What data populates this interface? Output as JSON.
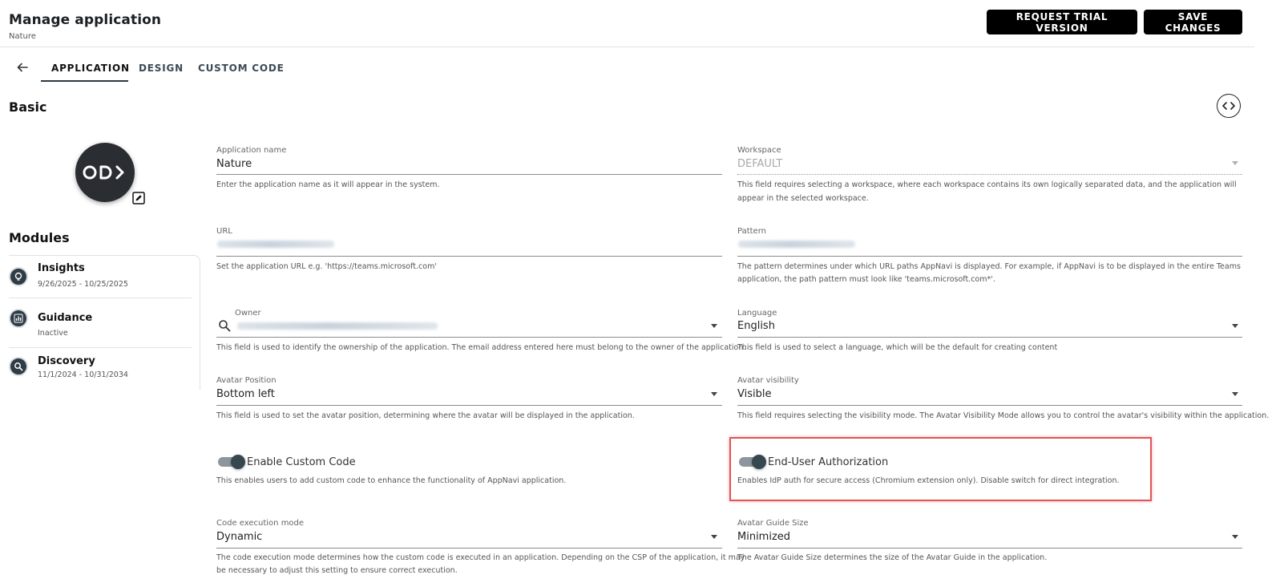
{
  "header": {
    "title": "Manage application",
    "subtitle": "Nature",
    "request_trial_label": "REQUEST TRIAL VERSION",
    "save_label": "SAVE CHANGES"
  },
  "tabs": [
    {
      "label": "APPLICATION",
      "active": true
    },
    {
      "label": "DESIGN",
      "active": false
    },
    {
      "label": "CUSTOM CODE",
      "active": false
    }
  ],
  "sections": {
    "basic": "Basic",
    "modules": "Modules"
  },
  "modules": [
    {
      "name": "Insights",
      "sub": "9/26/2025 - 10/25/2025",
      "icon": "insights-icon"
    },
    {
      "name": "Guidance",
      "sub": "Inactive",
      "icon": "bar-chart-icon"
    },
    {
      "name": "Discovery",
      "sub": "11/1/2024 - 10/31/2034",
      "icon": "search-icon"
    }
  ],
  "fields": {
    "app_name": {
      "label": "Application name",
      "value": "Nature",
      "help": "Enter the application name as it will appear in the system."
    },
    "workspace": {
      "label": "Workspace",
      "value": "DEFAULT",
      "help1": "This field requires selecting a workspace, where each workspace contains its own logically separated data, and the application will",
      "help2": "appear in the selected workspace."
    },
    "url": {
      "label": "URL",
      "help": "Set the application URL e.g. 'https://teams.microsoft.com'"
    },
    "pattern": {
      "label": "Pattern",
      "help1": "The pattern determines under which URL paths AppNavi is displayed. For example, if AppNavi is to be displayed in the entire Teams",
      "help2": "application, the path pattern must look like 'teams.microsoft.com*'."
    },
    "owner": {
      "label": "Owner",
      "help": "This field is used to identify the ownership of the application. The email address entered here must belong to the owner of the application."
    },
    "language": {
      "label": "Language",
      "value": "English",
      "help": "This field is used to select a language, which will be the default for creating content"
    },
    "avatar_position": {
      "label": "Avatar Position",
      "value": "Bottom left",
      "help": "This field is used to set the avatar position, determining where the avatar will be displayed in the application."
    },
    "avatar_visibility": {
      "label": "Avatar visibility",
      "value": "Visible",
      "help": "This field requires selecting the visibility mode. The Avatar Visibility Mode allows you to control the avatar's visibility within the application."
    },
    "custom_code": {
      "label": "Enable Custom Code",
      "help": "This enables users to add custom code to enhance the functionality of AppNavi application.",
      "enabled": true
    },
    "end_user_auth": {
      "label": "End-User Authorization",
      "help": "Enables IdP auth for secure access (Chromium extension only). Disable switch for direct integration.",
      "enabled": true
    },
    "code_execution": {
      "label": "Code execution mode",
      "value": "Dynamic",
      "help1": "The code execution mode determines how the custom code is executed in an application. Depending on the CSP of the application, it may",
      "help2": "be necessary to adjust this setting to ensure correct execution."
    },
    "guide_size": {
      "label": "Avatar Guide Size",
      "value": "Minimized",
      "help": "The Avatar Guide Size determines the size of the Avatar Guide in the application."
    }
  },
  "colors": {
    "button_bg": "#000000",
    "toggle_knob": "#37474f",
    "highlight": "#e05555"
  }
}
